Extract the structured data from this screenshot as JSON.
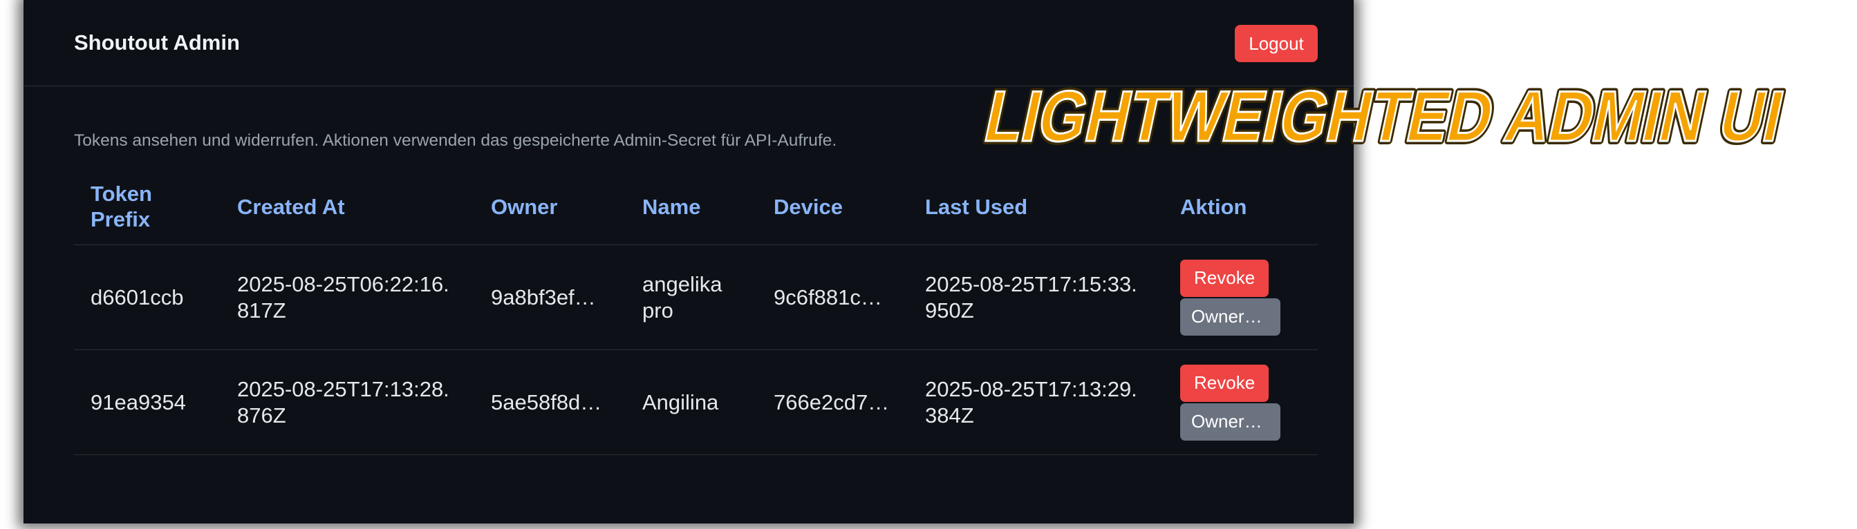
{
  "header": {
    "title": "Shoutout Admin",
    "logout_label": "Logout"
  },
  "description": "Tokens ansehen und widerrufen. Aktionen verwenden das gespeicherte Admin-Secret für API-Aufrufe.",
  "table": {
    "columns": [
      "Token Prefix",
      "Created At",
      "Owner",
      "Name",
      "Device",
      "Last Used",
      "Aktion"
    ],
    "rows": [
      {
        "token_prefix": "d6601ccb",
        "created_at": "2025-08-25T06:22:16.817Z",
        "owner": "9a8bf3ef…",
        "name": "angelika pro",
        "device": "9c6f881c…",
        "last_used": "2025-08-25T17:15:33.950Z",
        "revoke_label": "Revoke",
        "owner_button_label": "Owner…"
      },
      {
        "token_prefix": "91ea9354",
        "created_at": "2025-08-25T17:13:28.876Z",
        "owner": "5ae58f8d…",
        "name": "Angilina",
        "device": "766e2cd7…",
        "last_used": "2025-08-25T17:13:29.384Z",
        "revoke_label": "Revoke",
        "owner_button_label": "Owner…"
      }
    ]
  },
  "banner": {
    "text": "LIGHTWEIGHTED ADMIN UI"
  },
  "colors": {
    "background": "#0d1117",
    "accent_header": "#8ab4f8",
    "danger": "#ef4444",
    "secondary_button": "#6b7280",
    "banner": "#f5a300"
  }
}
